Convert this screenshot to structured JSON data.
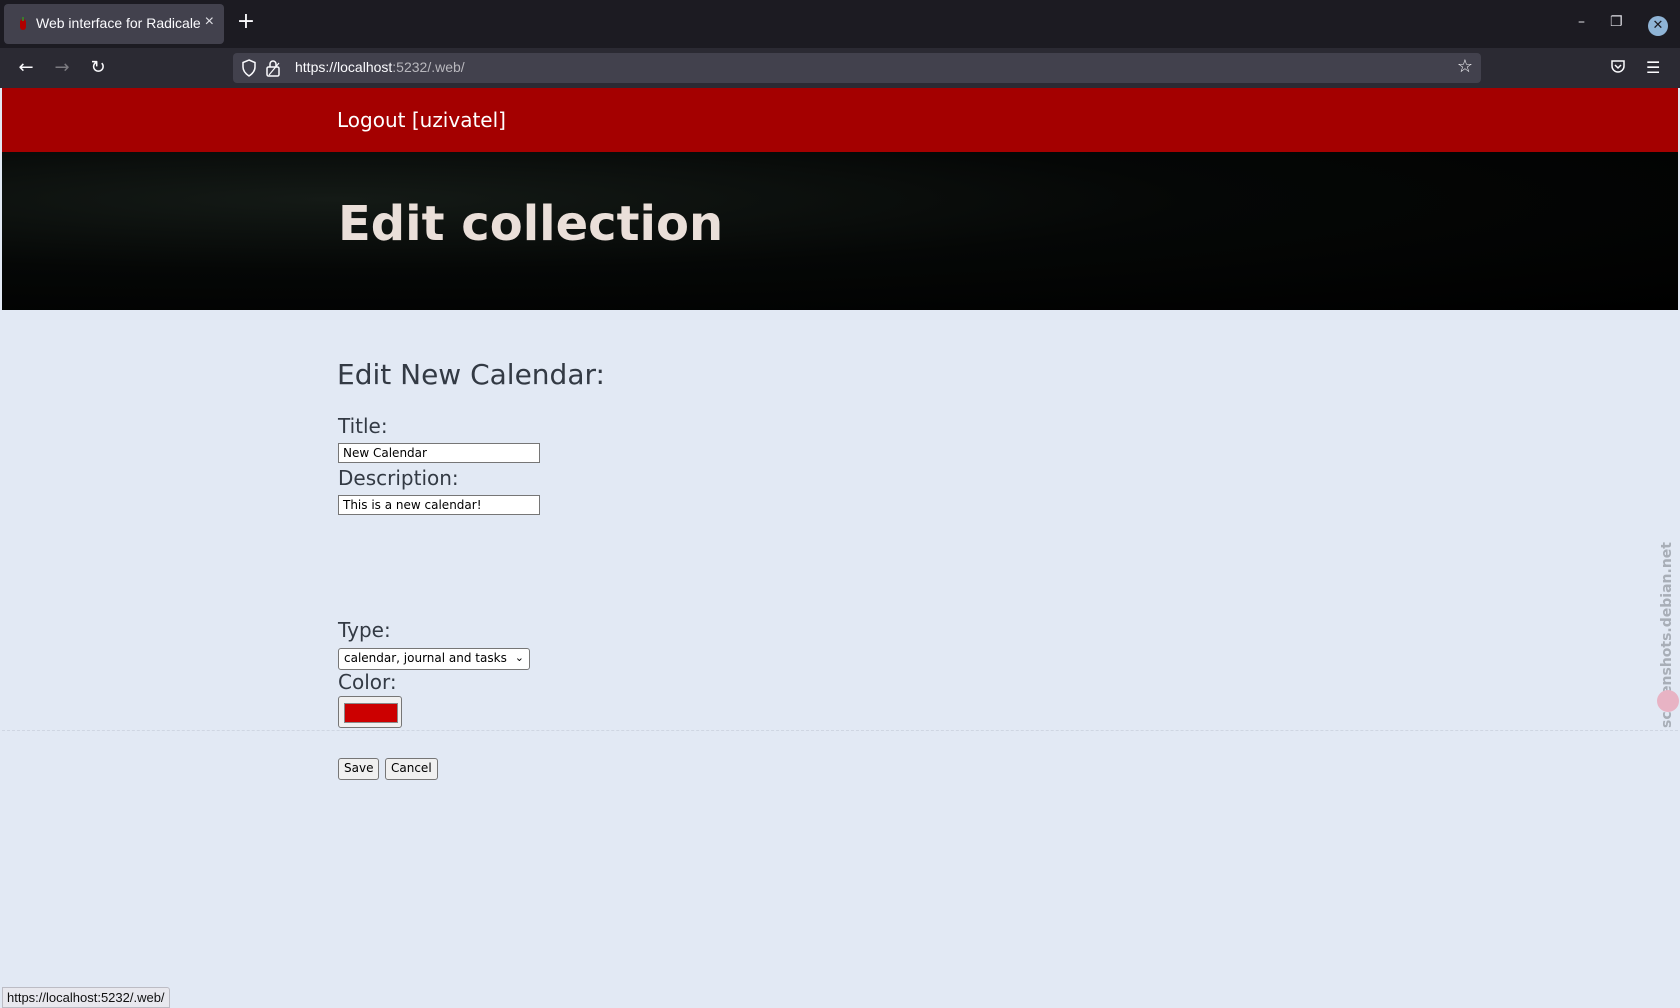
{
  "browser": {
    "tab_title": "Web interface for Radicale",
    "tab_close": "×",
    "new_tab": "+",
    "url_host": "https://localhost",
    "url_rest": ":5232/.web/",
    "status_url": "https://localhost:5232/.web/"
  },
  "header": {
    "logout_label": "Logout [uzivatel]",
    "page_title": "Edit collection"
  },
  "form": {
    "heading": "Edit New Calendar:",
    "title_label": "Title:",
    "title_value": "New Calendar",
    "description_label": "Description:",
    "description_value": "This is a new calendar!",
    "type_label": "Type:",
    "type_value": "calendar, journal and tasks",
    "color_label": "Color:",
    "color_value": "#cc0000",
    "save_label": "Save",
    "cancel_label": "Cancel"
  },
  "watermark": "screenshots.debian.net",
  "colors": {
    "topbar": "#a40000",
    "page_bg": "#e2e9f4"
  }
}
